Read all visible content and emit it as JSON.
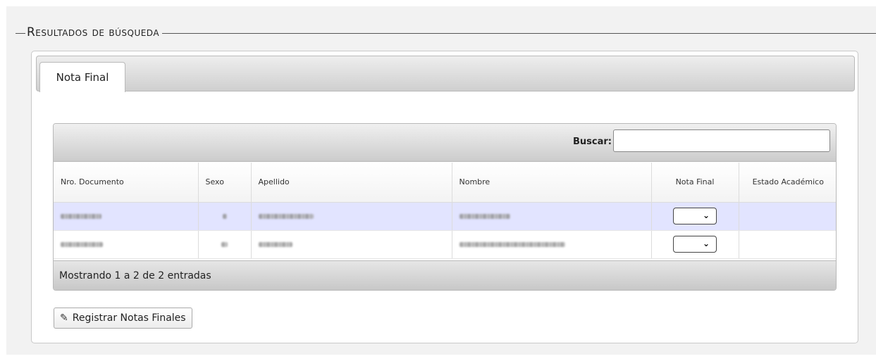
{
  "section": {
    "legend": "Resultados de búsqueda"
  },
  "tabs": [
    {
      "label": "Nota Final"
    }
  ],
  "table": {
    "search_label": "Buscar:",
    "search_value": "",
    "columns": [
      "Nro. Documento",
      "Sexo",
      "Apellido",
      "Nombre",
      "Nota Final",
      "Estado Académico"
    ],
    "rows": [
      {
        "nota_final": "",
        "estado_academico": ""
      },
      {
        "nota_final": "",
        "estado_academico": ""
      }
    ],
    "footer_info": "Mostrando 1 a 2 de 2 entradas"
  },
  "actions": {
    "register_label": "Registrar Notas Finales",
    "register_icon": "edit-icon"
  }
}
